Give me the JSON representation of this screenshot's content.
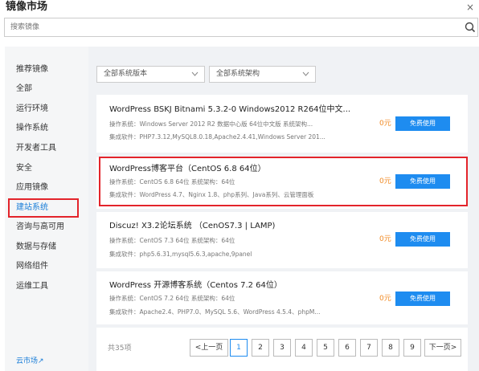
{
  "header": {
    "title": "镜像市场",
    "close_glyph": "×"
  },
  "search": {
    "placeholder": "搜索镜像",
    "icon": "search-icon"
  },
  "sidebar": {
    "items": [
      {
        "label": "推荐镜像"
      },
      {
        "label": "全部"
      },
      {
        "label": "运行环境"
      },
      {
        "label": "操作系统"
      },
      {
        "label": "开发者工具"
      },
      {
        "label": "安全"
      },
      {
        "label": "应用镜像"
      },
      {
        "label": "建站系统"
      },
      {
        "label": "咨询与高可用"
      },
      {
        "label": "数据与存储"
      },
      {
        "label": "网络组件"
      },
      {
        "label": "运维工具"
      }
    ],
    "active_label": "建站系统",
    "footer_link": "云市场↗"
  },
  "filters": {
    "version": "全部系统版本",
    "arch": "全部系统架构"
  },
  "cards": [
    {
      "title": "WordPress BSKJ Bitnami 5.3.2-0 Windows2012 R264位中文...",
      "os": "操作系统：Windows Server 2012 R2 数据中心版 64位中文版   系统架构...",
      "software": "集成软件：PHP7.3.12,MySQL8.0.18,Apache2.4.41,Windows Server 201...",
      "price": "0元",
      "button": "免费使用"
    },
    {
      "title": "WordPress博客平台（CentOS 6.8 64位）",
      "os": "操作系统：CentOS 6.8 64位   系统架构：64位",
      "software": "集成软件：WordPress 4.7、Nginx 1.8、php系列、Java系列、云管理面板",
      "price": "0元",
      "button": "免费使用"
    },
    {
      "title": "Discuz! X3.2论坛系统 （CenOS7.3 | LAMP)",
      "os": "操作系统：CentOS 7.3 64位   系统架构：64位",
      "software": "集成软件：php5.6.31,mysql5.6.3,apache,9panel",
      "price": "0元",
      "button": "免费使用"
    },
    {
      "title": "WordPress 开源博客系统（Centos 7.2 64位）",
      "os": "操作系统：CentOS 7.2 64位   系统架构：64位",
      "software": "集成软件：Apache2.4、PHP7.0、MySQL 5.6、WordPress 4.5.4、phpM...",
      "price": "0元",
      "button": "免费使用"
    }
  ],
  "pagination": {
    "total": "共35项",
    "prev": "<上一页",
    "next": "下一页>",
    "pages": [
      "1",
      "2",
      "3",
      "4",
      "5",
      "6",
      "7",
      "8",
      "9"
    ],
    "current": "1"
  },
  "colors": {
    "accent": "#1e8cf0",
    "highlight": "#e3242b",
    "price": "#f08a24"
  }
}
